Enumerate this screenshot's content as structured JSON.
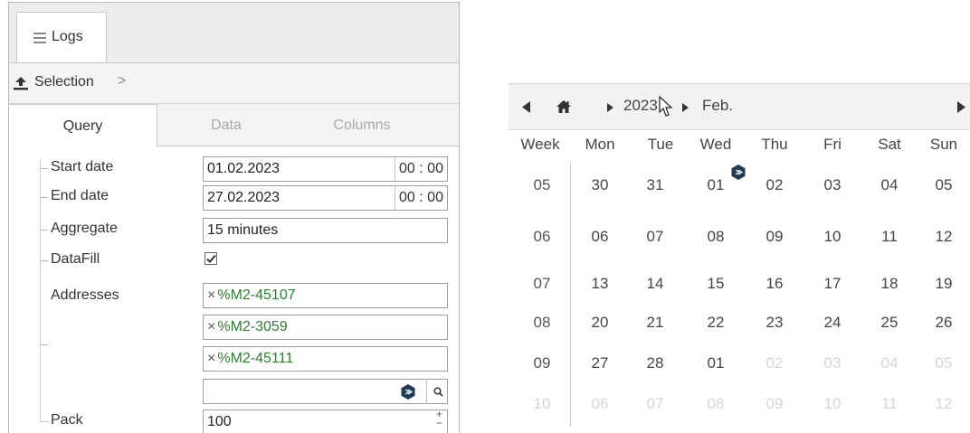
{
  "tab_logs": {
    "label": "Logs",
    "icon": "menu-icon"
  },
  "selection": {
    "label": "Selection",
    "icon": "upload-icon",
    "chevron": ">"
  },
  "subtabs": [
    {
      "label": "Query",
      "active": true
    },
    {
      "label": "Data",
      "active": false
    },
    {
      "label": "Columns",
      "active": false
    }
  ],
  "form": {
    "start_date": {
      "label": "Start date",
      "value": "01.02.2023",
      "time": "00 : 00"
    },
    "end_date": {
      "label": "End date",
      "value": "27.02.2023",
      "time": "00 : 00"
    },
    "aggregate": {
      "label": "Aggregate",
      "value": "15 minutes"
    },
    "datafill": {
      "label": "DataFill",
      "checked": true
    },
    "addresses": {
      "label": "Addresses",
      "items": [
        {
          "remove": "×",
          "value": "%M2-45107"
        },
        {
          "remove": "×",
          "value": "%M2-3059"
        },
        {
          "remove": "×",
          "value": "%M2-45111"
        }
      ],
      "new_value": ""
    },
    "pack": {
      "label": "Pack",
      "value": "100",
      "plus": "+",
      "minus": "−"
    }
  },
  "calendar": {
    "year": "2023",
    "month": "Feb.",
    "headers": [
      "Week",
      "Mon",
      "Tue",
      "Wed",
      "Thu",
      "Fri",
      "Sat",
      "Sun"
    ],
    "rows": [
      {
        "week": "05",
        "days": [
          "30",
          "31",
          "01",
          "02",
          "03",
          "04",
          "05"
        ],
        "dim": [
          false,
          false,
          false,
          false,
          false,
          false,
          false
        ]
      },
      {
        "week": "06",
        "days": [
          "06",
          "07",
          "08",
          "09",
          "10",
          "11",
          "12"
        ],
        "dim": [
          false,
          false,
          false,
          false,
          false,
          false,
          false
        ]
      },
      {
        "week": "07",
        "days": [
          "13",
          "14",
          "15",
          "16",
          "17",
          "18",
          "19"
        ],
        "dim": [
          false,
          false,
          false,
          false,
          false,
          false,
          false
        ]
      },
      {
        "week": "08",
        "days": [
          "20",
          "21",
          "22",
          "23",
          "24",
          "25",
          "26"
        ],
        "dim": [
          false,
          false,
          false,
          false,
          false,
          false,
          false
        ]
      },
      {
        "week": "09",
        "days": [
          "27",
          "28",
          "01",
          "02",
          "03",
          "04",
          "05"
        ],
        "dim": [
          false,
          false,
          false,
          true,
          true,
          true,
          true
        ]
      },
      {
        "week": "10",
        "days": [
          "06",
          "07",
          "08",
          "09",
          "10",
          "11",
          "12"
        ],
        "dim": [
          true,
          true,
          true,
          true,
          true,
          true,
          true
        ],
        "week_dim": true
      }
    ]
  },
  "colors": {
    "address_green": "#2e7d32",
    "dim_text": "#d6d6d6"
  }
}
